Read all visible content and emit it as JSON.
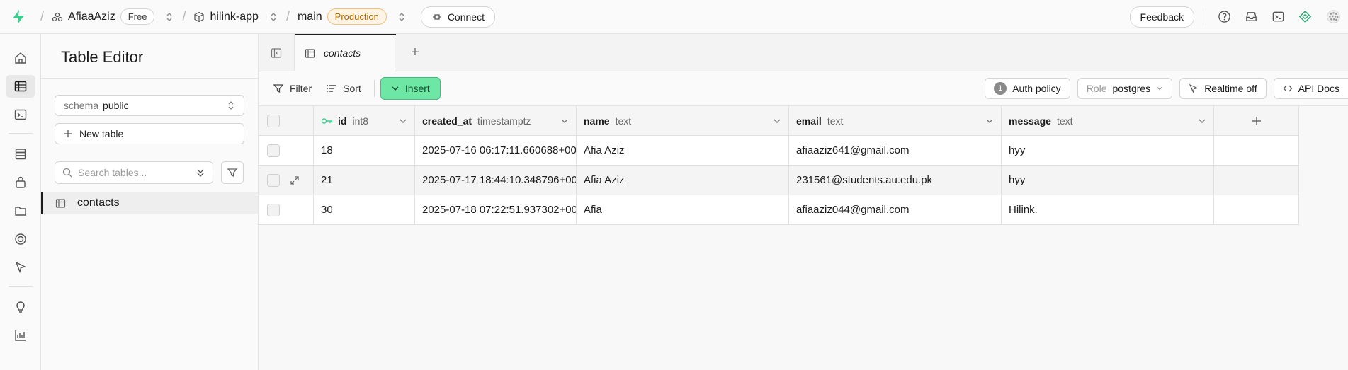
{
  "topbar": {
    "org": "AfiaaAziz",
    "plan": "Free",
    "project": "hilink-app",
    "branch": "main",
    "env": "Production",
    "connect_label": "Connect",
    "feedback_label": "Feedback"
  },
  "sidebar": {
    "title": "Table Editor",
    "schema_label": "schema",
    "schema_value": "public",
    "new_table_label": "New table",
    "search_placeholder": "Search tables...",
    "tables": [
      "contacts"
    ]
  },
  "tabs": [
    {
      "label": "contacts"
    }
  ],
  "toolbar": {
    "filter_label": "Filter",
    "sort_label": "Sort",
    "insert_label": "Insert",
    "auth_policy_count": "1",
    "auth_policy_label": "Auth policy",
    "role_label": "Role",
    "role_value": "postgres",
    "realtime_label": "Realtime off",
    "api_docs_label": "API Docs"
  },
  "columns": [
    {
      "name": "id",
      "type": "int8",
      "key": true
    },
    {
      "name": "created_at",
      "type": "timestamptz"
    },
    {
      "name": "name",
      "type": "text"
    },
    {
      "name": "email",
      "type": "text"
    },
    {
      "name": "message",
      "type": "text"
    }
  ],
  "rows": [
    {
      "id": "18",
      "created_at": "2025-07-16 06:17:11.660688+00",
      "name": "Afia Aziz",
      "email": "afiaaziz641@gmail.com",
      "message": "hyy"
    },
    {
      "id": "21",
      "created_at": "2025-07-17 18:44:10.348796+00",
      "name": "Afia Aziz",
      "email": "231561@students.au.edu.pk",
      "message": "hyy"
    },
    {
      "id": "30",
      "created_at": "2025-07-18 07:22:51.937302+00",
      "name": "Afia",
      "email": "afiaaziz044@gmail.com",
      "message": "Hilink."
    }
  ],
  "colors": {
    "accent": "#3ecf8e",
    "insert_bg": "#6ee7a5",
    "production": "#b06a00"
  }
}
